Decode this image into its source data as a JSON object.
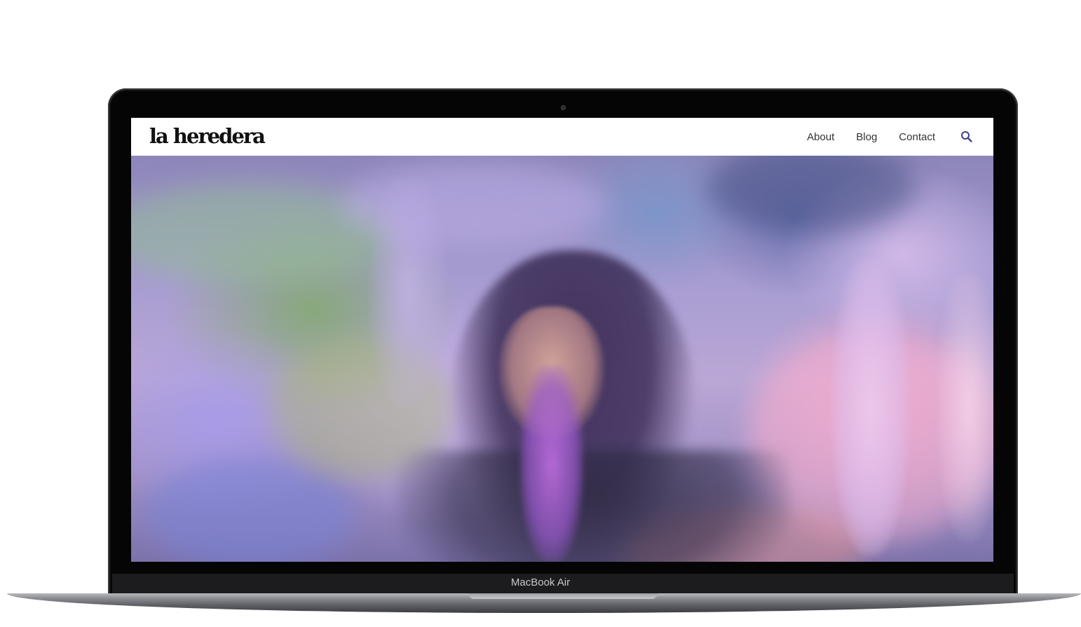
{
  "site": {
    "logo": "la heredera",
    "nav": [
      {
        "label": "About"
      },
      {
        "label": "Blog"
      },
      {
        "label": "Contact"
      }
    ],
    "search_icon": "search-icon"
  },
  "device": {
    "label": "MacBook Air"
  },
  "colors": {
    "nav_text": "#333333",
    "search_icon": "#3b3f8f",
    "bezel": "#050505"
  }
}
